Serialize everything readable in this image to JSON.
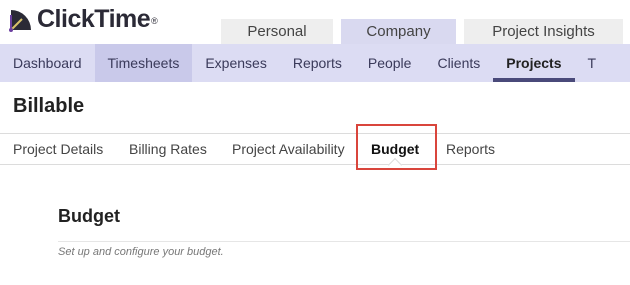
{
  "brand": {
    "name": "ClickTime",
    "registered": "®",
    "logo_icon": "clock-icon",
    "colors": {
      "logo_text": "#2b2a36",
      "logo_accent": "#6b3fa0"
    }
  },
  "top_tabs": [
    {
      "label": "Personal",
      "active": false
    },
    {
      "label": "Company",
      "active": true
    },
    {
      "label": "Project Insights",
      "active": false
    }
  ],
  "main_nav": {
    "items": [
      {
        "label": "Dashboard"
      },
      {
        "label": "Timesheets"
      },
      {
        "label": "Expenses"
      },
      {
        "label": "Reports"
      },
      {
        "label": "People"
      },
      {
        "label": "Clients"
      },
      {
        "label": "Projects"
      },
      {
        "label": "T"
      }
    ],
    "active": "Projects",
    "highlighted": "Timesheets"
  },
  "page": {
    "title": "Billable"
  },
  "sub_nav": {
    "items": [
      {
        "label": "Project Details"
      },
      {
        "label": "Billing Rates"
      },
      {
        "label": "Project Availability"
      },
      {
        "label": "Budget"
      },
      {
        "label": "Reports"
      }
    ],
    "active": "Budget",
    "highlight_color": "#d9453c"
  },
  "section": {
    "title": "Budget",
    "description": "Set up and configure your budget."
  }
}
